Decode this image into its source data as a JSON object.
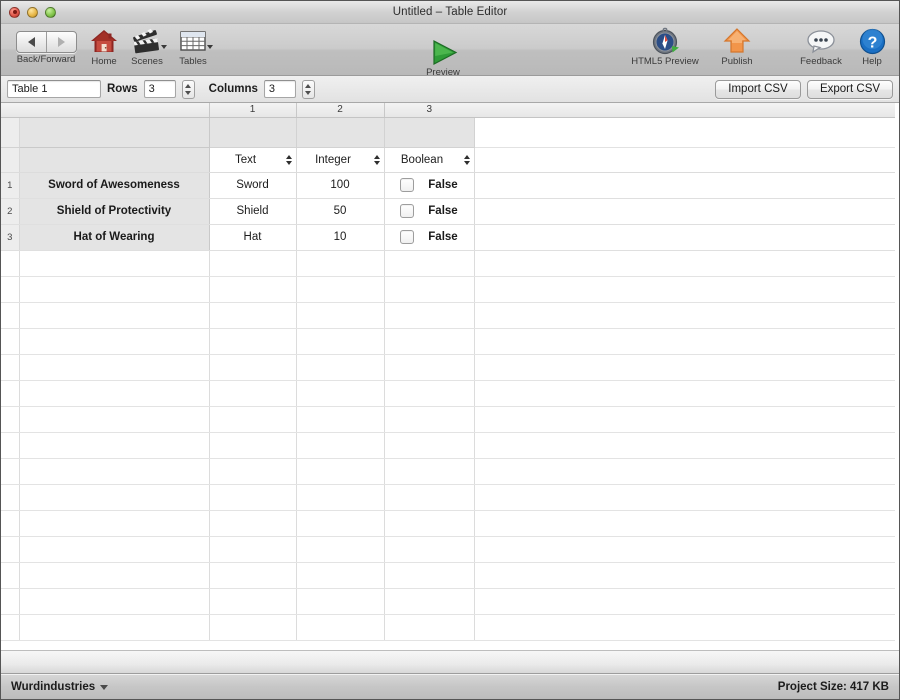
{
  "window": {
    "title": "Untitled – Table Editor",
    "traffic_lights": [
      "close",
      "minimize",
      "zoom"
    ]
  },
  "toolbar": {
    "items": [
      {
        "name": "back-forward",
        "label": "Back/Forward",
        "icon": "back-forward-segmented"
      },
      {
        "name": "home",
        "label": "Home",
        "icon": "house-icon"
      },
      {
        "name": "scenes",
        "label": "Scenes",
        "icon": "clapperboard-icon"
      },
      {
        "name": "tables",
        "label": "Tables",
        "icon": "table-grid-icon"
      },
      {
        "name": "preview",
        "label": "Preview",
        "icon": "green-play-icon"
      },
      {
        "name": "html5-preview",
        "label": "HTML5 Preview",
        "icon": "compass-icon"
      },
      {
        "name": "publish",
        "label": "Publish",
        "icon": "orange-up-arrow-icon"
      },
      {
        "name": "feedback",
        "label": "Feedback",
        "icon": "speech-bubble-icon"
      },
      {
        "name": "help",
        "label": "Help",
        "icon": "question-mark-icon"
      }
    ]
  },
  "options": {
    "table_name": "Table 1",
    "table_name_placeholder": "Table name",
    "rows_label": "Rows",
    "rows_value": "3",
    "columns_label": "Columns",
    "columns_value": "3",
    "import_csv": "Import CSV",
    "export_csv": "Export CSV"
  },
  "table": {
    "column_numbers": [
      "1",
      "2",
      "3"
    ],
    "column_types": [
      "Text",
      "Integer",
      "Boolean"
    ],
    "rows": [
      {
        "number": "1",
        "name": "Sword of Awesomeness",
        "cells": [
          {
            "type": "text",
            "value": "Sword"
          },
          {
            "type": "integer",
            "value": "100"
          },
          {
            "type": "boolean",
            "value": "False",
            "checked": false
          }
        ]
      },
      {
        "number": "2",
        "name": "Shield of Protectivity",
        "cells": [
          {
            "type": "text",
            "value": "Shield"
          },
          {
            "type": "integer",
            "value": "50"
          },
          {
            "type": "boolean",
            "value": "False",
            "checked": false
          }
        ]
      },
      {
        "number": "3",
        "name": "Hat of Wearing",
        "cells": [
          {
            "type": "text",
            "value": "Hat"
          },
          {
            "type": "integer",
            "value": "10"
          },
          {
            "type": "boolean",
            "value": "False",
            "checked": false
          }
        ]
      }
    ],
    "empty_row_count": 15
  },
  "statusbar": {
    "organization": "Wurdindustries",
    "project_size": "Project Size: 417 KB"
  },
  "colors": {
    "accent_green": "#2a9a34",
    "accent_orange": "#f08a35",
    "accent_blue": "#1c6cc0",
    "row_header_bg": "#e4e4e4",
    "toolbar_bg": "#c6c6c6"
  }
}
